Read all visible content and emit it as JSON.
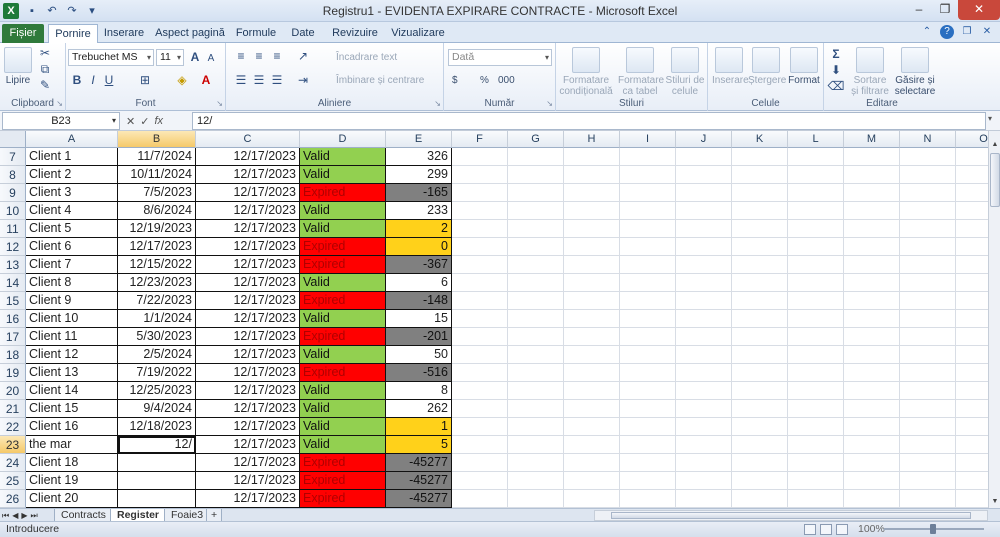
{
  "window": {
    "title": "Registru1 - EVIDENTA EXPIRARE CONTRACTE - Microsoft Excel",
    "app_icon": "X",
    "controls": [
      "–",
      "❐",
      "✕"
    ]
  },
  "ribbon_tabs": [
    "Fișier",
    "Pornire",
    "Inserare",
    "Aspect pagină",
    "Formule",
    "Date",
    "Revizuire",
    "Vizualizare"
  ],
  "active_ribbon_tab": "Pornire",
  "ribbon": {
    "clipboard": {
      "paste": "Lipire",
      "label": "Clipboard"
    },
    "font": {
      "name": "Trebuchet MS",
      "size": "11",
      "bold": "B",
      "italic": "I",
      "underline": "U",
      "label": "Font"
    },
    "alignment": {
      "wrap": "Încadrare text",
      "merge": "Îmbinare și centrare",
      "label": "Aliniere"
    },
    "number": {
      "format": "Dată",
      "currency": "$",
      "percent": "%",
      "comma": "000",
      "label": "Număr"
    },
    "styles": {
      "conditional": "Formatare condițională",
      "table": "Formatare ca tabel",
      "cell": "Stiluri de celule",
      "label": "Stiluri"
    },
    "cells": {
      "insert": "Inserare",
      "delete": "Ștergere",
      "format": "Format",
      "label": "Celule"
    },
    "editing": {
      "sum": "Σ",
      "sort": "Sortare și filtrare",
      "find": "Găsire și selectare",
      "label": "Editare"
    }
  },
  "formula_bar": {
    "name_box": "B23",
    "fx": "fx",
    "content": "12/"
  },
  "columns": [
    "A",
    "B",
    "C",
    "D",
    "E",
    "F",
    "G",
    "H",
    "I",
    "J",
    "K",
    "L",
    "M",
    "N",
    "O"
  ],
  "selected_column": "B",
  "selected_row": "23",
  "rows": [
    {
      "num": "7",
      "a": "Client 1",
      "b": "11/7/2024",
      "c": "12/17/2023",
      "d": "Valid",
      "e": "326",
      "status": "valid",
      "days": "pos"
    },
    {
      "num": "8",
      "a": "Client 2",
      "b": "10/11/2024",
      "c": "12/17/2023",
      "d": "Valid",
      "e": "299",
      "status": "valid",
      "days": "pos"
    },
    {
      "num": "9",
      "a": "Client 3",
      "b": "7/5/2023",
      "c": "12/17/2023",
      "d": "Expired",
      "e": "-165",
      "status": "expired",
      "days": "neg"
    },
    {
      "num": "10",
      "a": "Client 4",
      "b": "8/6/2024",
      "c": "12/17/2023",
      "d": "Valid",
      "e": "233",
      "status": "valid",
      "days": "pos"
    },
    {
      "num": "11",
      "a": "Client 5",
      "b": "12/19/2023",
      "c": "12/17/2023",
      "d": "Valid",
      "e": "2",
      "status": "valid",
      "days": "warn"
    },
    {
      "num": "12",
      "a": "Client 6",
      "b": "12/17/2023",
      "c": "12/17/2023",
      "d": "Expired",
      "e": "0",
      "status": "expired",
      "days": "warn"
    },
    {
      "num": "13",
      "a": "Client 7",
      "b": "12/15/2022",
      "c": "12/17/2023",
      "d": "Expired",
      "e": "-367",
      "status": "expired",
      "days": "neg"
    },
    {
      "num": "14",
      "a": "Client 8",
      "b": "12/23/2023",
      "c": "12/17/2023",
      "d": "Valid",
      "e": "6",
      "status": "valid",
      "days": "pos"
    },
    {
      "num": "15",
      "a": "Client 9",
      "b": "7/22/2023",
      "c": "12/17/2023",
      "d": "Expired",
      "e": "-148",
      "status": "expired",
      "days": "neg"
    },
    {
      "num": "16",
      "a": "Client 10",
      "b": "1/1/2024",
      "c": "12/17/2023",
      "d": "Valid",
      "e": "15",
      "status": "valid",
      "days": "pos"
    },
    {
      "num": "17",
      "a": "Client 11",
      "b": "5/30/2023",
      "c": "12/17/2023",
      "d": "Expired",
      "e": "-201",
      "status": "expired",
      "days": "neg"
    },
    {
      "num": "18",
      "a": "Client 12",
      "b": "2/5/2024",
      "c": "12/17/2023",
      "d": "Valid",
      "e": "50",
      "status": "valid",
      "days": "pos"
    },
    {
      "num": "19",
      "a": "Client 13",
      "b": "7/19/2022",
      "c": "12/17/2023",
      "d": "Expired",
      "e": "-516",
      "status": "expired",
      "days": "neg"
    },
    {
      "num": "20",
      "a": "Client 14",
      "b": "12/25/2023",
      "c": "12/17/2023",
      "d": "Valid",
      "e": "8",
      "status": "valid",
      "days": "pos"
    },
    {
      "num": "21",
      "a": "Client 15",
      "b": "9/4/2024",
      "c": "12/17/2023",
      "d": "Valid",
      "e": "262",
      "status": "valid",
      "days": "pos"
    },
    {
      "num": "22",
      "a": "Client 16",
      "b": "12/18/2023",
      "c": "12/17/2023",
      "d": "Valid",
      "e": "1",
      "status": "valid",
      "days": "warn"
    },
    {
      "num": "23",
      "a": "the mar",
      "b": "12/",
      "c": "12/17/2023",
      "d": "Valid",
      "e": "5",
      "status": "valid",
      "days": "warn"
    },
    {
      "num": "24",
      "a": "Client 18",
      "b": "",
      "c": "12/17/2023",
      "d": "Expired",
      "e": "-45277",
      "status": "expired",
      "days": "neg"
    },
    {
      "num": "25",
      "a": "Client 19",
      "b": "",
      "c": "12/17/2023",
      "d": "Expired",
      "e": "-45277",
      "status": "expired",
      "days": "neg"
    },
    {
      "num": "26",
      "a": "Client 20",
      "b": "",
      "c": "12/17/2023",
      "d": "Expired",
      "e": "-45277",
      "status": "expired",
      "days": "neg"
    }
  ],
  "sheets": [
    "Contracts",
    "Register",
    "Foaie3"
  ],
  "active_sheet": "Register",
  "status_bar": {
    "mode": "Introducere",
    "zoom": "100%"
  },
  "colors": {
    "valid": "#92d050",
    "expired": "#ff0000",
    "negative": "#808080",
    "warning": "#ffd11a",
    "file_tab": "#2f7a3b"
  }
}
